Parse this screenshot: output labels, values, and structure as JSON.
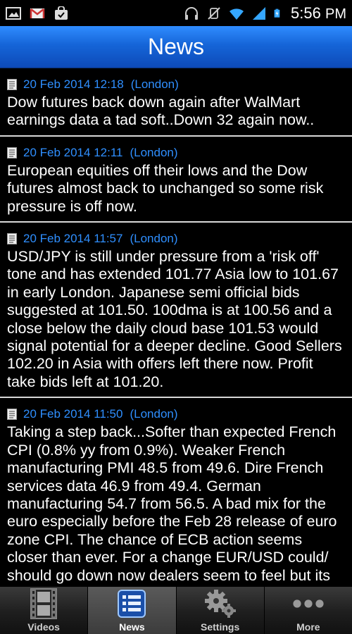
{
  "status_bar": {
    "time": "5:56",
    "ampm": "PM",
    "icons": [
      "gallery-icon",
      "gmail-icon",
      "shopping-bag-icon",
      "headset-icon",
      "mute-icon",
      "wifi-icon",
      "signal-icon",
      "battery-charging-icon"
    ]
  },
  "header": {
    "title": "News"
  },
  "news": [
    {
      "date": "20 Feb 2014 12:18",
      "location": "(London)",
      "text": "Dow futures back down again after WalMart earnings data a tad soft..Down 32 again now.."
    },
    {
      "date": "20 Feb 2014 12:11",
      "location": "(London)",
      "text": "European equities off their lows and the Dow futures almost back to unchanged so some risk pressure is off now."
    },
    {
      "date": "20 Feb 2014 11:57",
      "location": "(London)",
      "text": "USD/JPY is still under pressure from a 'risk off' tone and has extended 101.77 Asia low to 101.67 in early London. Japanese semi official bids suggested at 101.50. 100dma is at 100.56 and a close below the daily cloud base 101.53 would signal potential for a deeper decline. Good Sellers 102.20 in Asia with offers left there now. Profit take bids left at 101.20."
    },
    {
      "date": "20 Feb 2014 11:50",
      "location": "(London)",
      "text": "Taking a step back...Softer than expected French CPI (0.8% yy from 0.9%). Weaker French manufacturing PMI 48.5 from 49.6. Dire French services data 46.9 from 49.4. German manufacturing 54.7 from 56.5. A bad mix for the euro especially before the Feb 28 release of euro zone CPI. The chance of ECB action seems closer than ever. For a change EUR/USD could/ should go down now dealers seem to feel but its"
    }
  ],
  "tabs": [
    {
      "label": "Videos",
      "icon": "film-icon",
      "active": false
    },
    {
      "label": "News",
      "icon": "news-list-icon",
      "active": true
    },
    {
      "label": "Settings",
      "icon": "gears-icon",
      "active": false
    },
    {
      "label": "More",
      "icon": "more-dots-icon",
      "active": false
    }
  ],
  "colors": {
    "accent_blue": "#2f8fff",
    "header_blue": "#1565d8",
    "background": "#000000",
    "divider": "#d8d8d8"
  }
}
